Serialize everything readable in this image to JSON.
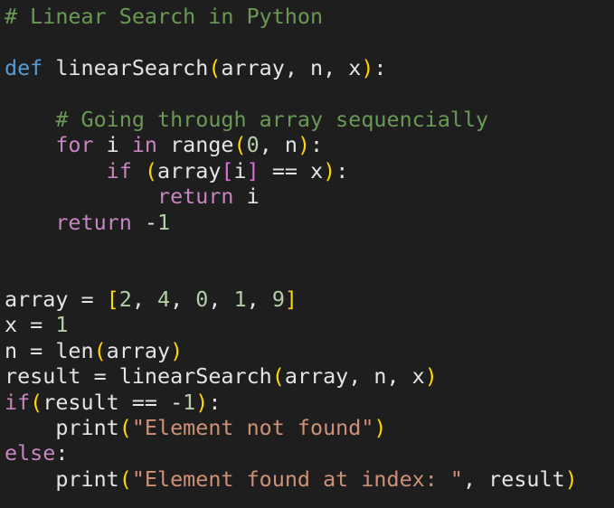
{
  "code": {
    "language": "Python",
    "lines": [
      [
        [
          "comment",
          "# Linear Search in Python"
        ]
      ],
      [],
      [
        [
          "def",
          "def"
        ],
        [
          "plain",
          " linearSearch"
        ],
        [
          "paren",
          "("
        ],
        [
          "plain",
          "array, n, x"
        ],
        [
          "paren",
          ")"
        ],
        [
          "plain",
          ":"
        ]
      ],
      [],
      [
        [
          "plain",
          "    "
        ],
        [
          "comment",
          "# Going through array sequencially"
        ]
      ],
      [
        [
          "plain",
          "    "
        ],
        [
          "kw",
          "for"
        ],
        [
          "plain",
          " i "
        ],
        [
          "kw",
          "in"
        ],
        [
          "plain",
          " range"
        ],
        [
          "paren",
          "("
        ],
        [
          "num",
          "0"
        ],
        [
          "plain",
          ", n"
        ],
        [
          "paren",
          ")"
        ],
        [
          "plain",
          ":"
        ]
      ],
      [
        [
          "plain",
          "        "
        ],
        [
          "kw",
          "if"
        ],
        [
          "plain",
          " "
        ],
        [
          "paren",
          "("
        ],
        [
          "plain",
          "array"
        ],
        [
          "bracket",
          "["
        ],
        [
          "plain",
          "i"
        ],
        [
          "bracket",
          "]"
        ],
        [
          "plain",
          " == x"
        ],
        [
          "paren",
          ")"
        ],
        [
          "plain",
          ":"
        ]
      ],
      [
        [
          "plain",
          "            "
        ],
        [
          "kw",
          "return"
        ],
        [
          "plain",
          " i"
        ]
      ],
      [
        [
          "plain",
          "    "
        ],
        [
          "kw",
          "return"
        ],
        [
          "plain",
          " -"
        ],
        [
          "num",
          "1"
        ]
      ],
      [],
      [],
      [
        [
          "plain",
          "array = "
        ],
        [
          "paren",
          "["
        ],
        [
          "num",
          "2"
        ],
        [
          "plain",
          ", "
        ],
        [
          "num",
          "4"
        ],
        [
          "plain",
          ", "
        ],
        [
          "num",
          "0"
        ],
        [
          "plain",
          ", "
        ],
        [
          "num",
          "1"
        ],
        [
          "plain",
          ", "
        ],
        [
          "num",
          "9"
        ],
        [
          "paren",
          "]"
        ]
      ],
      [
        [
          "plain",
          "x = "
        ],
        [
          "num",
          "1"
        ]
      ],
      [
        [
          "plain",
          "n = len"
        ],
        [
          "paren",
          "("
        ],
        [
          "plain",
          "array"
        ],
        [
          "paren",
          ")"
        ]
      ],
      [
        [
          "plain",
          "result = linearSearch"
        ],
        [
          "paren",
          "("
        ],
        [
          "plain",
          "array, n, x"
        ],
        [
          "paren",
          ")"
        ]
      ],
      [
        [
          "kw",
          "if"
        ],
        [
          "paren",
          "("
        ],
        [
          "plain",
          "result == -"
        ],
        [
          "num",
          "1"
        ],
        [
          "paren",
          ")"
        ],
        [
          "plain",
          ":"
        ]
      ],
      [
        [
          "plain",
          "    print"
        ],
        [
          "paren",
          "("
        ],
        [
          "str",
          "\"Element not found\""
        ],
        [
          "paren",
          ")"
        ]
      ],
      [
        [
          "kw",
          "else"
        ],
        [
          "plain",
          ":"
        ]
      ],
      [
        [
          "plain",
          "    print"
        ],
        [
          "paren",
          "("
        ],
        [
          "str",
          "\"Element found at index: \""
        ],
        [
          "plain",
          ", result"
        ],
        [
          "paren",
          ")"
        ]
      ]
    ]
  }
}
